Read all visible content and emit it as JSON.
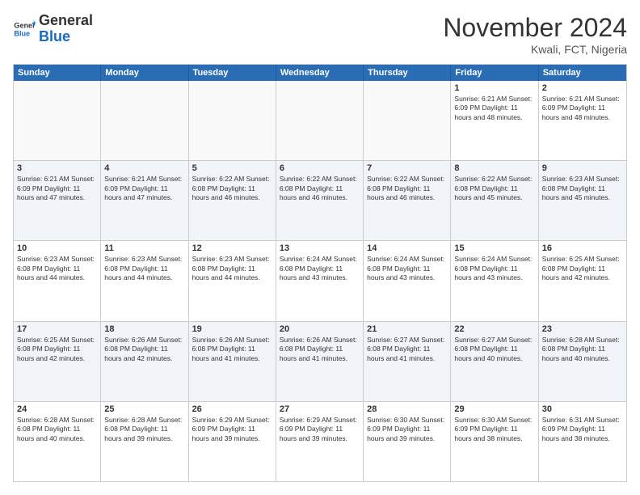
{
  "header": {
    "logo": {
      "general": "General",
      "blue": "Blue"
    },
    "title": "November 2024",
    "location": "Kwali, FCT, Nigeria"
  },
  "weekdays": [
    "Sunday",
    "Monday",
    "Tuesday",
    "Wednesday",
    "Thursday",
    "Friday",
    "Saturday"
  ],
  "rows": [
    [
      {
        "day": "",
        "empty": true,
        "text": ""
      },
      {
        "day": "",
        "empty": true,
        "text": ""
      },
      {
        "day": "",
        "empty": true,
        "text": ""
      },
      {
        "day": "",
        "empty": true,
        "text": ""
      },
      {
        "day": "",
        "empty": true,
        "text": ""
      },
      {
        "day": "1",
        "text": "Sunrise: 6:21 AM\nSunset: 6:09 PM\nDaylight: 11 hours and 48 minutes."
      },
      {
        "day": "2",
        "text": "Sunrise: 6:21 AM\nSunset: 6:09 PM\nDaylight: 11 hours and 48 minutes."
      }
    ],
    [
      {
        "day": "3",
        "text": "Sunrise: 6:21 AM\nSunset: 6:09 PM\nDaylight: 11 hours and 47 minutes."
      },
      {
        "day": "4",
        "text": "Sunrise: 6:21 AM\nSunset: 6:09 PM\nDaylight: 11 hours and 47 minutes."
      },
      {
        "day": "5",
        "text": "Sunrise: 6:22 AM\nSunset: 6:08 PM\nDaylight: 11 hours and 46 minutes."
      },
      {
        "day": "6",
        "text": "Sunrise: 6:22 AM\nSunset: 6:08 PM\nDaylight: 11 hours and 46 minutes."
      },
      {
        "day": "7",
        "text": "Sunrise: 6:22 AM\nSunset: 6:08 PM\nDaylight: 11 hours and 46 minutes."
      },
      {
        "day": "8",
        "text": "Sunrise: 6:22 AM\nSunset: 6:08 PM\nDaylight: 11 hours and 45 minutes."
      },
      {
        "day": "9",
        "text": "Sunrise: 6:23 AM\nSunset: 6:08 PM\nDaylight: 11 hours and 45 minutes."
      }
    ],
    [
      {
        "day": "10",
        "text": "Sunrise: 6:23 AM\nSunset: 6:08 PM\nDaylight: 11 hours and 44 minutes."
      },
      {
        "day": "11",
        "text": "Sunrise: 6:23 AM\nSunset: 6:08 PM\nDaylight: 11 hours and 44 minutes."
      },
      {
        "day": "12",
        "text": "Sunrise: 6:23 AM\nSunset: 6:08 PM\nDaylight: 11 hours and 44 minutes."
      },
      {
        "day": "13",
        "text": "Sunrise: 6:24 AM\nSunset: 6:08 PM\nDaylight: 11 hours and 43 minutes."
      },
      {
        "day": "14",
        "text": "Sunrise: 6:24 AM\nSunset: 6:08 PM\nDaylight: 11 hours and 43 minutes."
      },
      {
        "day": "15",
        "text": "Sunrise: 6:24 AM\nSunset: 6:08 PM\nDaylight: 11 hours and 43 minutes."
      },
      {
        "day": "16",
        "text": "Sunrise: 6:25 AM\nSunset: 6:08 PM\nDaylight: 11 hours and 42 minutes."
      }
    ],
    [
      {
        "day": "17",
        "text": "Sunrise: 6:25 AM\nSunset: 6:08 PM\nDaylight: 11 hours and 42 minutes."
      },
      {
        "day": "18",
        "text": "Sunrise: 6:26 AM\nSunset: 6:08 PM\nDaylight: 11 hours and 42 minutes."
      },
      {
        "day": "19",
        "text": "Sunrise: 6:26 AM\nSunset: 6:08 PM\nDaylight: 11 hours and 41 minutes."
      },
      {
        "day": "20",
        "text": "Sunrise: 6:26 AM\nSunset: 6:08 PM\nDaylight: 11 hours and 41 minutes."
      },
      {
        "day": "21",
        "text": "Sunrise: 6:27 AM\nSunset: 6:08 PM\nDaylight: 11 hours and 41 minutes."
      },
      {
        "day": "22",
        "text": "Sunrise: 6:27 AM\nSunset: 6:08 PM\nDaylight: 11 hours and 40 minutes."
      },
      {
        "day": "23",
        "text": "Sunrise: 6:28 AM\nSunset: 6:08 PM\nDaylight: 11 hours and 40 minutes."
      }
    ],
    [
      {
        "day": "24",
        "text": "Sunrise: 6:28 AM\nSunset: 6:08 PM\nDaylight: 11 hours and 40 minutes."
      },
      {
        "day": "25",
        "text": "Sunrise: 6:28 AM\nSunset: 6:08 PM\nDaylight: 11 hours and 39 minutes."
      },
      {
        "day": "26",
        "text": "Sunrise: 6:29 AM\nSunset: 6:09 PM\nDaylight: 11 hours and 39 minutes."
      },
      {
        "day": "27",
        "text": "Sunrise: 6:29 AM\nSunset: 6:09 PM\nDaylight: 11 hours and 39 minutes."
      },
      {
        "day": "28",
        "text": "Sunrise: 6:30 AM\nSunset: 6:09 PM\nDaylight: 11 hours and 39 minutes."
      },
      {
        "day": "29",
        "text": "Sunrise: 6:30 AM\nSunset: 6:09 PM\nDaylight: 11 hours and 38 minutes."
      },
      {
        "day": "30",
        "text": "Sunrise: 6:31 AM\nSunset: 6:09 PM\nDaylight: 11 hours and 38 minutes."
      }
    ]
  ]
}
